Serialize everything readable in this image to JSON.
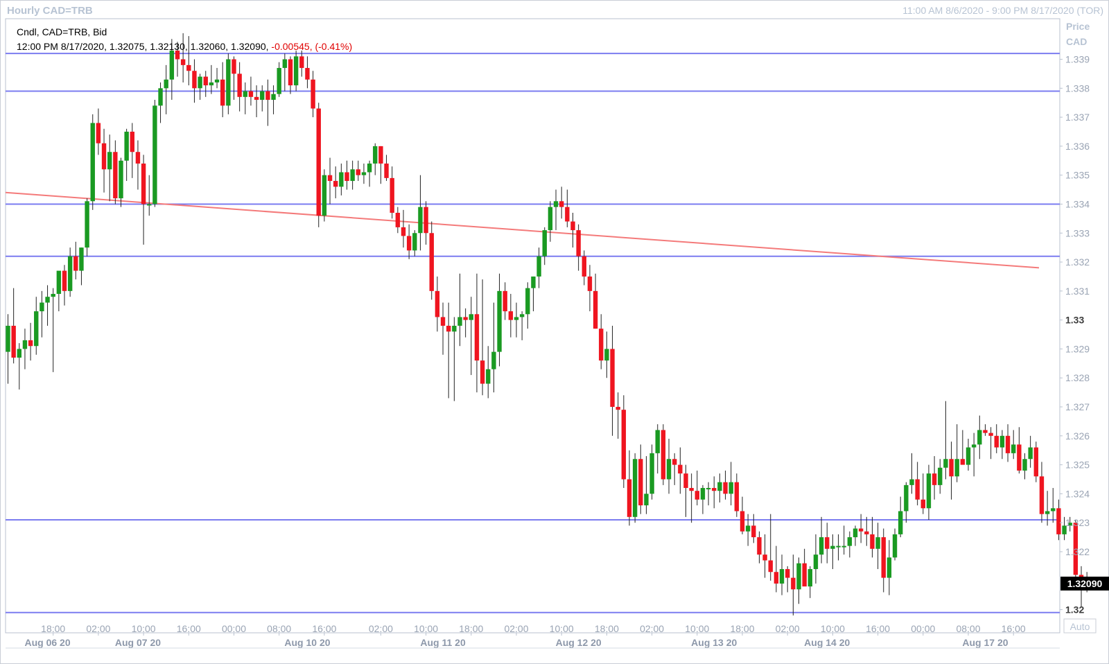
{
  "header": {
    "title": "Hourly CAD=TRB",
    "range": "11:00 AM 8/6/2020 - 9:00 PM 8/17/2020 (TOR)"
  },
  "legend": {
    "line1": "Cndl, CAD=TRB, Bid",
    "line2": "12:00 PM 8/17/2020, 1.32075, 1.32130, 1.32060, 1.32090,",
    "change": " -0.00545, (-0.41%)"
  },
  "axis": {
    "price_label": "Price",
    "currency_label": "CAD",
    "auto_label": "Auto",
    "last_price": "1.32090"
  },
  "colors": {
    "up": "#1a9a22",
    "down": "#ef1520",
    "hline": "#7b7cf0",
    "trendline": "#f47a7a",
    "last_price_bg": "#000000"
  },
  "chart_data": {
    "type": "candlestick",
    "title": "Hourly CAD=TRB",
    "ylim": [
      1.3192,
      1.3404
    ],
    "y_ticks": [
      {
        "value": 1.339,
        "label": "1.339"
      },
      {
        "value": 1.338,
        "label": "1.338"
      },
      {
        "value": 1.337,
        "label": "1.337"
      },
      {
        "value": 1.336,
        "label": "1.336"
      },
      {
        "value": 1.335,
        "label": "1.335"
      },
      {
        "value": 1.334,
        "label": "1.334"
      },
      {
        "value": 1.333,
        "label": "1.333"
      },
      {
        "value": 1.332,
        "label": "1.332"
      },
      {
        "value": 1.331,
        "label": "1.331"
      },
      {
        "value": 1.33,
        "label": "1.33",
        "major": true
      },
      {
        "value": 1.329,
        "label": "1.329"
      },
      {
        "value": 1.328,
        "label": "1.328"
      },
      {
        "value": 1.327,
        "label": "1.327"
      },
      {
        "value": 1.326,
        "label": "1.326"
      },
      {
        "value": 1.325,
        "label": "1.325"
      },
      {
        "value": 1.324,
        "label": "1.324"
      },
      {
        "value": 1.323,
        "label": "1.323"
      },
      {
        "value": 1.322,
        "label": "1.322"
      },
      {
        "value": 1.32,
        "label": "1.32",
        "major": true
      }
    ],
    "x_time_ticks": [
      {
        "i": 8,
        "label": "18:00"
      },
      {
        "i": 16,
        "label": "02:00"
      },
      {
        "i": 24,
        "label": "10:00"
      },
      {
        "i": 32,
        "label": "16:00"
      },
      {
        "i": 40,
        "label": "00:00"
      },
      {
        "i": 48,
        "label": "08:00"
      },
      {
        "i": 56,
        "label": "16:00"
      },
      {
        "i": 66,
        "label": "02:00"
      },
      {
        "i": 74,
        "label": "10:00"
      },
      {
        "i": 82,
        "label": "18:00"
      },
      {
        "i": 90,
        "label": "02:00"
      },
      {
        "i": 98,
        "label": "10:00"
      },
      {
        "i": 106,
        "label": "18:00"
      },
      {
        "i": 114,
        "label": "02:00"
      },
      {
        "i": 122,
        "label": "10:00"
      },
      {
        "i": 130,
        "label": "18:00"
      },
      {
        "i": 138,
        "label": "02:00"
      },
      {
        "i": 146,
        "label": "10:00"
      },
      {
        "i": 154,
        "label": "16:00"
      },
      {
        "i": 162,
        "label": "00:00"
      },
      {
        "i": 170,
        "label": "08:00"
      },
      {
        "i": 178,
        "label": "16:00"
      }
    ],
    "x_date_labels": [
      {
        "i": 7,
        "label": "Aug 06 20"
      },
      {
        "i": 23,
        "label": "Aug 07 20"
      },
      {
        "i": 53,
        "label": "Aug 10 20"
      },
      {
        "i": 77,
        "label": "Aug 11 20"
      },
      {
        "i": 101,
        "label": "Aug 12 20"
      },
      {
        "i": 125,
        "label": "Aug 13 20"
      },
      {
        "i": 145,
        "label": "Aug 14 20"
      },
      {
        "i": 173,
        "label": "Aug 17 20"
      }
    ],
    "horizontal_lines": [
      1.3392,
      1.3379,
      1.334,
      1.3322,
      1.3231,
      1.3199
    ],
    "trendline": {
      "from": {
        "i": 0,
        "y": 1.3344
      },
      "to": {
        "i": 183,
        "y": 1.3318
      }
    },
    "candles": [
      [
        1.3289,
        1.3302,
        1.3278,
        1.3298
      ],
      [
        1.3298,
        1.3311,
        1.3285,
        1.3287
      ],
      [
        1.3287,
        1.3292,
        1.3276,
        1.329
      ],
      [
        1.329,
        1.3297,
        1.3283,
        1.3293
      ],
      [
        1.3293,
        1.3299,
        1.3286,
        1.3291
      ],
      [
        1.3291,
        1.3308,
        1.3288,
        1.3303
      ],
      [
        1.3303,
        1.331,
        1.3294,
        1.3306
      ],
      [
        1.3306,
        1.3312,
        1.3298,
        1.3308
      ],
      [
        1.3308,
        1.3311,
        1.3282,
        1.3309
      ],
      [
        1.3309,
        1.3315,
        1.3303,
        1.3317
      ],
      [
        1.3317,
        1.3319,
        1.3305,
        1.331
      ],
      [
        1.331,
        1.3325,
        1.3308,
        1.3322
      ],
      [
        1.3322,
        1.3327,
        1.3314,
        1.3317
      ],
      [
        1.3317,
        1.3325,
        1.3312,
        1.3325
      ],
      [
        1.3325,
        1.3342,
        1.3322,
        1.3341
      ],
      [
        1.3341,
        1.3371,
        1.3338,
        1.3368
      ],
      [
        1.3368,
        1.3373,
        1.3357,
        1.3361
      ],
      [
        1.3361,
        1.3366,
        1.3344,
        1.3352
      ],
      [
        1.3352,
        1.3364,
        1.3341,
        1.3358
      ],
      [
        1.3358,
        1.3362,
        1.334,
        1.3342
      ],
      [
        1.3342,
        1.3356,
        1.3339,
        1.3355
      ],
      [
        1.3355,
        1.3366,
        1.3348,
        1.3365
      ],
      [
        1.3365,
        1.3368,
        1.3349,
        1.3358
      ],
      [
        1.3358,
        1.3362,
        1.3345,
        1.3354
      ],
      [
        1.3354,
        1.3357,
        1.3326,
        1.334
      ],
      [
        1.334,
        1.335,
        1.3336,
        1.334
      ],
      [
        1.334,
        1.3376,
        1.3339,
        1.3374
      ],
      [
        1.3374,
        1.3382,
        1.3368,
        1.338
      ],
      [
        1.338,
        1.3388,
        1.3371,
        1.3383
      ],
      [
        1.3383,
        1.3397,
        1.3376,
        1.3393
      ],
      [
        1.3393,
        1.3396,
        1.3384,
        1.339
      ],
      [
        1.339,
        1.3399,
        1.3382,
        1.3388
      ],
      [
        1.3388,
        1.3398,
        1.3381,
        1.3386
      ],
      [
        1.3386,
        1.339,
        1.3375,
        1.338
      ],
      [
        1.338,
        1.3385,
        1.3376,
        1.3384
      ],
      [
        1.3384,
        1.3386,
        1.3377,
        1.3381
      ],
      [
        1.3381,
        1.3388,
        1.3378,
        1.3382
      ],
      [
        1.3382,
        1.3387,
        1.338,
        1.3383
      ],
      [
        1.3383,
        1.3389,
        1.337,
        1.3374
      ],
      [
        1.3374,
        1.3392,
        1.3371,
        1.339
      ],
      [
        1.339,
        1.3391,
        1.3376,
        1.3385
      ],
      [
        1.3385,
        1.3389,
        1.3372,
        1.3377
      ],
      [
        1.3377,
        1.3382,
        1.3371,
        1.3379
      ],
      [
        1.3379,
        1.3384,
        1.3374,
        1.3377
      ],
      [
        1.3377,
        1.3381,
        1.337,
        1.3376
      ],
      [
        1.3376,
        1.3381,
        1.3372,
        1.3379
      ],
      [
        1.3379,
        1.3383,
        1.3367,
        1.3376
      ],
      [
        1.3376,
        1.3381,
        1.3371,
        1.3378
      ],
      [
        1.3378,
        1.3389,
        1.3377,
        1.3387
      ],
      [
        1.3387,
        1.3392,
        1.3379,
        1.339
      ],
      [
        1.339,
        1.3391,
        1.3378,
        1.3381
      ],
      [
        1.3381,
        1.3393,
        1.3379,
        1.3391
      ],
      [
        1.3391,
        1.3393,
        1.3384,
        1.3387
      ],
      [
        1.3387,
        1.3391,
        1.338,
        1.3383
      ],
      [
        1.3383,
        1.3386,
        1.337,
        1.3373
      ],
      [
        1.3373,
        1.3375,
        1.3332,
        1.3336
      ],
      [
        1.3336,
        1.3352,
        1.3334,
        1.335
      ],
      [
        1.335,
        1.3356,
        1.334,
        1.3348
      ],
      [
        1.3348,
        1.3353,
        1.3342,
        1.3346
      ],
      [
        1.3346,
        1.3354,
        1.3343,
        1.3351
      ],
      [
        1.3351,
        1.3355,
        1.3345,
        1.3348
      ],
      [
        1.3348,
        1.3355,
        1.3345,
        1.3352
      ],
      [
        1.3352,
        1.3355,
        1.3348,
        1.335
      ],
      [
        1.335,
        1.3354,
        1.3347,
        1.3351
      ],
      [
        1.3351,
        1.3355,
        1.3346,
        1.3354
      ],
      [
        1.3354,
        1.3361,
        1.335,
        1.336
      ],
      [
        1.336,
        1.336,
        1.3347,
        1.3354
      ],
      [
        1.3354,
        1.3357,
        1.3348,
        1.3349
      ],
      [
        1.3349,
        1.3353,
        1.3335,
        1.3337
      ],
      [
        1.3337,
        1.3339,
        1.333,
        1.3332
      ],
      [
        1.3332,
        1.3338,
        1.3325,
        1.3329
      ],
      [
        1.3329,
        1.3333,
        1.3321,
        1.3324
      ],
      [
        1.3324,
        1.3331,
        1.3322,
        1.333
      ],
      [
        1.333,
        1.335,
        1.3324,
        1.3339
      ],
      [
        1.3339,
        1.3341,
        1.3326,
        1.333
      ],
      [
        1.333,
        1.3334,
        1.3307,
        1.331
      ],
      [
        1.331,
        1.3315,
        1.3296,
        1.3301
      ],
      [
        1.3301,
        1.3306,
        1.3288,
        1.3298
      ],
      [
        1.3298,
        1.3306,
        1.3273,
        1.3296
      ],
      [
        1.3296,
        1.3301,
        1.3272,
        1.3298
      ],
      [
        1.3298,
        1.3316,
        1.3291,
        1.3301
      ],
      [
        1.3301,
        1.3304,
        1.3294,
        1.33
      ],
      [
        1.33,
        1.3308,
        1.3281,
        1.3302
      ],
      [
        1.3302,
        1.3316,
        1.3275,
        1.3286
      ],
      [
        1.3286,
        1.3314,
        1.3274,
        1.3278
      ],
      [
        1.3278,
        1.3291,
        1.3273,
        1.3283
      ],
      [
        1.3283,
        1.3306,
        1.3275,
        1.3289
      ],
      [
        1.3289,
        1.3316,
        1.3284,
        1.331
      ],
      [
        1.331,
        1.3313,
        1.33,
        1.3303
      ],
      [
        1.3303,
        1.3309,
        1.3294,
        1.33
      ],
      [
        1.33,
        1.3306,
        1.3294,
        1.3301
      ],
      [
        1.3301,
        1.3303,
        1.3293,
        1.3302
      ],
      [
        1.3302,
        1.3313,
        1.3297,
        1.3311
      ],
      [
        1.3311,
        1.3315,
        1.3303,
        1.3315
      ],
      [
        1.3315,
        1.3325,
        1.3311,
        1.3322
      ],
      [
        1.3322,
        1.3332,
        1.3319,
        1.3331
      ],
      [
        1.3331,
        1.3341,
        1.3327,
        1.3339
      ],
      [
        1.3339,
        1.3345,
        1.3331,
        1.3341
      ],
      [
        1.3341,
        1.3346,
        1.3335,
        1.3339
      ],
      [
        1.3339,
        1.3345,
        1.3332,
        1.3334
      ],
      [
        1.3334,
        1.3337,
        1.3325,
        1.3331
      ],
      [
        1.3331,
        1.3333,
        1.3317,
        1.3322
      ],
      [
        1.3322,
        1.3324,
        1.3312,
        1.3315
      ],
      [
        1.3315,
        1.3319,
        1.3303,
        1.331
      ],
      [
        1.331,
        1.3316,
        1.3297,
        1.3297
      ],
      [
        1.3297,
        1.3302,
        1.3283,
        1.3286
      ],
      [
        1.3286,
        1.3296,
        1.328,
        1.329
      ],
      [
        1.329,
        1.3298,
        1.326,
        1.327
      ],
      [
        1.327,
        1.3275,
        1.3259,
        1.3269
      ],
      [
        1.3269,
        1.3274,
        1.3242,
        1.3245
      ],
      [
        1.3245,
        1.3255,
        1.3229,
        1.3232
      ],
      [
        1.3232,
        1.3254,
        1.323,
        1.3252
      ],
      [
        1.3252,
        1.3257,
        1.3233,
        1.3236
      ],
      [
        1.3236,
        1.3253,
        1.3233,
        1.324
      ],
      [
        1.324,
        1.3257,
        1.3238,
        1.3254
      ],
      [
        1.3254,
        1.3264,
        1.3247,
        1.3262
      ],
      [
        1.3262,
        1.3264,
        1.3243,
        1.3245
      ],
      [
        1.3245,
        1.3259,
        1.324,
        1.3252
      ],
      [
        1.3252,
        1.3254,
        1.3243,
        1.325
      ],
      [
        1.325,
        1.3256,
        1.324,
        1.3247
      ],
      [
        1.3247,
        1.325,
        1.3232,
        1.3242
      ],
      [
        1.3242,
        1.3247,
        1.323,
        1.3241
      ],
      [
        1.3241,
        1.3248,
        1.3236,
        1.3238
      ],
      [
        1.3238,
        1.3243,
        1.3233,
        1.3242
      ],
      [
        1.3242,
        1.3244,
        1.3236,
        1.3242
      ],
      [
        1.3242,
        1.3246,
        1.3235,
        1.3241
      ],
      [
        1.3241,
        1.3247,
        1.3237,
        1.3244
      ],
      [
        1.3244,
        1.3248,
        1.3238,
        1.324
      ],
      [
        1.324,
        1.3251,
        1.3236,
        1.3244
      ],
      [
        1.3244,
        1.3247,
        1.3232,
        1.3234
      ],
      [
        1.3234,
        1.3239,
        1.3226,
        1.3227
      ],
      [
        1.3227,
        1.3233,
        1.3222,
        1.3229
      ],
      [
        1.3229,
        1.3233,
        1.3223,
        1.3225
      ],
      [
        1.3225,
        1.3227,
        1.3216,
        1.3219
      ],
      [
        1.3219,
        1.3226,
        1.3211,
        1.3217
      ],
      [
        1.3217,
        1.3233,
        1.321,
        1.3213
      ],
      [
        1.3213,
        1.3222,
        1.3206,
        1.3209
      ],
      [
        1.3209,
        1.3219,
        1.3205,
        1.3214
      ],
      [
        1.3214,
        1.3215,
        1.3206,
        1.3211
      ],
      [
        1.3211,
        1.3219,
        1.3198,
        1.3207
      ],
      [
        1.3207,
        1.3218,
        1.3202,
        1.3216
      ],
      [
        1.3216,
        1.3221,
        1.3211,
        1.3208
      ],
      [
        1.3208,
        1.3215,
        1.3204,
        1.3214
      ],
      [
        1.3214,
        1.3226,
        1.3209,
        1.3219
      ],
      [
        1.3219,
        1.3232,
        1.3216,
        1.3225
      ],
      [
        1.3225,
        1.323,
        1.3216,
        1.3221
      ],
      [
        1.3221,
        1.3226,
        1.3214,
        1.3222
      ],
      [
        1.3222,
        1.3226,
        1.3217,
        1.3222
      ],
      [
        1.3222,
        1.3229,
        1.3219,
        1.3222
      ],
      [
        1.3222,
        1.3227,
        1.3218,
        1.3225
      ],
      [
        1.3225,
        1.3229,
        1.3222,
        1.3228
      ],
      [
        1.3228,
        1.3233,
        1.3223,
        1.3227
      ],
      [
        1.3227,
        1.3232,
        1.3222,
        1.3226
      ],
      [
        1.3226,
        1.3232,
        1.3218,
        1.3221
      ],
      [
        1.3221,
        1.323,
        1.3214,
        1.3225
      ],
      [
        1.3225,
        1.3228,
        1.3206,
        1.3211
      ],
      [
        1.3211,
        1.3224,
        1.3205,
        1.3218
      ],
      [
        1.3218,
        1.3228,
        1.3217,
        1.3226
      ],
      [
        1.3226,
        1.3239,
        1.3225,
        1.3234
      ],
      [
        1.3234,
        1.3244,
        1.323,
        1.3243
      ],
      [
        1.3243,
        1.3254,
        1.324,
        1.3245
      ],
      [
        1.3245,
        1.3251,
        1.3236,
        1.3238
      ],
      [
        1.3238,
        1.3247,
        1.3233,
        1.3235
      ],
      [
        1.3235,
        1.325,
        1.3231,
        1.3247
      ],
      [
        1.3247,
        1.3253,
        1.3238,
        1.3243
      ],
      [
        1.3243,
        1.3252,
        1.324,
        1.3249
      ],
      [
        1.3249,
        1.3272,
        1.3245,
        1.3252
      ],
      [
        1.3252,
        1.3258,
        1.3238,
        1.3246
      ],
      [
        1.3246,
        1.3264,
        1.3244,
        1.3252
      ],
      [
        1.3252,
        1.3262,
        1.3251,
        1.325
      ],
      [
        1.325,
        1.3259,
        1.3248,
        1.3256
      ],
      [
        1.3256,
        1.3261,
        1.3246,
        1.3257
      ],
      [
        1.3257,
        1.3267,
        1.3252,
        1.3262
      ],
      [
        1.3262,
        1.3264,
        1.326,
        1.3261
      ],
      [
        1.3261,
        1.3263,
        1.3252,
        1.326
      ],
      [
        1.326,
        1.3264,
        1.3254,
        1.3256
      ],
      [
        1.3256,
        1.3262,
        1.3252,
        1.326
      ],
      [
        1.326,
        1.3264,
        1.3251,
        1.3254
      ],
      [
        1.3254,
        1.3262,
        1.3252,
        1.3257
      ],
      [
        1.3257,
        1.3263,
        1.3247,
        1.3248
      ],
      [
        1.3248,
        1.3254,
        1.3245,
        1.3252
      ],
      [
        1.3252,
        1.326,
        1.3249,
        1.3256
      ],
      [
        1.3256,
        1.3258,
        1.3244,
        1.3246
      ],
      [
        1.3246,
        1.3251,
        1.323,
        1.3233
      ],
      [
        1.3233,
        1.3241,
        1.3229,
        1.3234
      ],
      [
        1.3234,
        1.3242,
        1.323,
        1.3235
      ],
      [
        1.3235,
        1.3238,
        1.3224,
        1.3226
      ],
      [
        1.3226,
        1.3232,
        1.3224,
        1.3229
      ],
      [
        1.3229,
        1.3232,
        1.3227,
        1.323
      ],
      [
        1.323,
        1.3231,
        1.3209,
        1.3212
      ],
      [
        1.3212,
        1.3215,
        1.3201,
        1.321
      ],
      [
        1.321,
        1.3213,
        1.3206,
        1.3209
      ]
    ]
  }
}
